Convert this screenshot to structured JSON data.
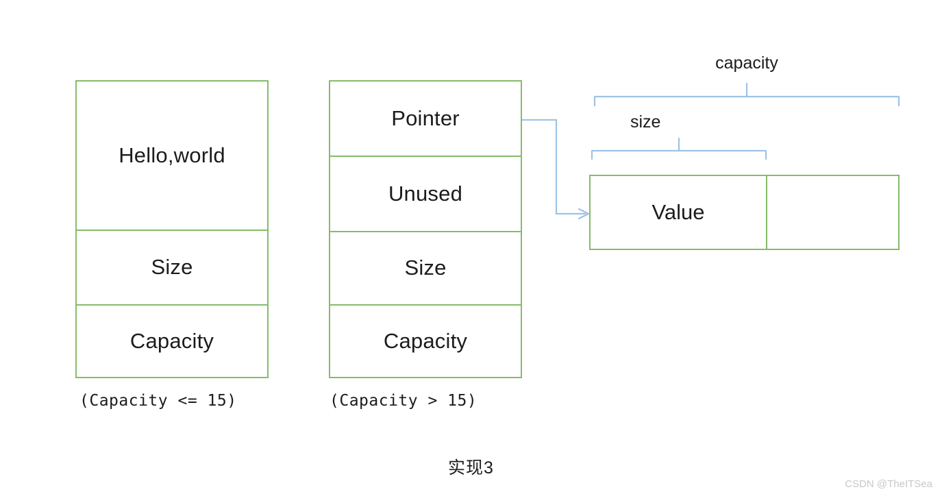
{
  "figure": {
    "caption": "实现3",
    "watermark": "CSDN @TheITSea",
    "accent_green": "#86bb6a",
    "accent_blue": "#9dc3e6",
    "background": "#ffffff",
    "text_color": "#1c1c1c"
  },
  "struct_inline": {
    "name": "short-string-optimization-layout",
    "note": "(Capacity <= 15)",
    "cells": [
      {
        "label": "Hello,world"
      },
      {
        "label": "Size"
      },
      {
        "label": "Capacity"
      }
    ]
  },
  "struct_heap": {
    "name": "heap-allocated-layout",
    "note": "(Capacity > 15)",
    "cells": [
      {
        "label": "Pointer"
      },
      {
        "label": "Unused"
      },
      {
        "label": "Size"
      },
      {
        "label": "Capacity"
      }
    ]
  },
  "heap_buffer": {
    "cells": [
      {
        "label": "Value"
      },
      {
        "label": ""
      }
    ],
    "brackets": [
      {
        "label": "capacity",
        "spans": "entire buffer"
      },
      {
        "label": "size",
        "spans": "value region only"
      }
    ]
  },
  "connector": {
    "from": "Pointer",
    "to": "Value",
    "style": "elbow-arrow"
  }
}
